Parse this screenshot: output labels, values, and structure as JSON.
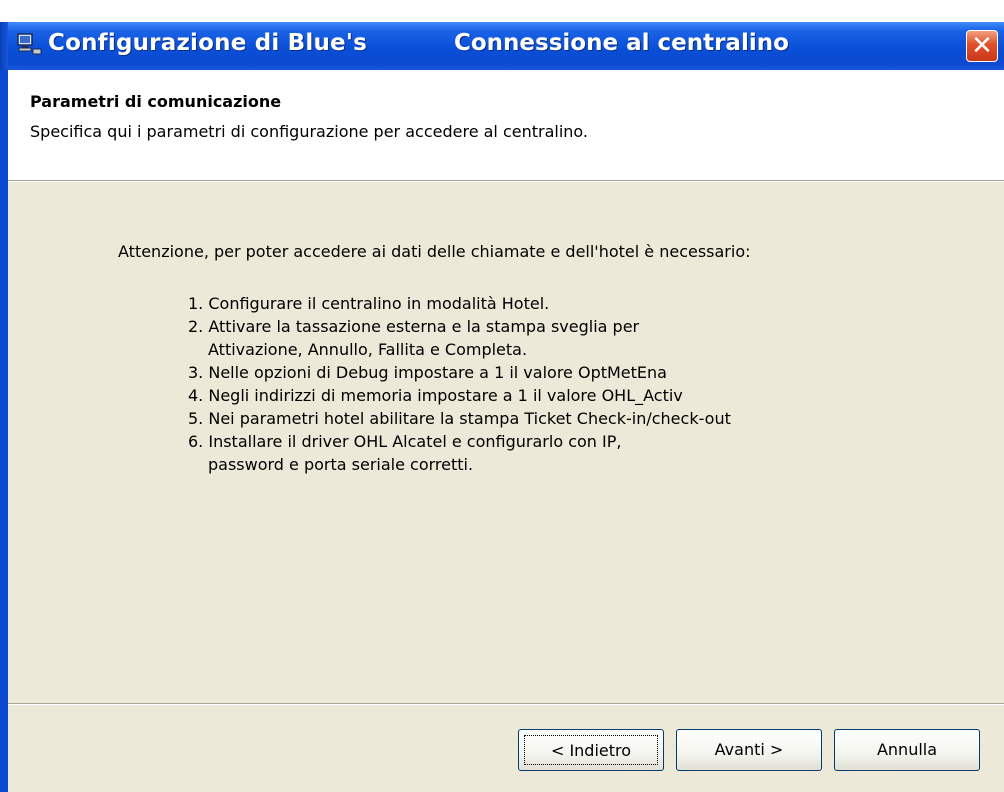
{
  "window": {
    "app_title": "Configurazione di Blue's",
    "step_title": "Connessione al centralino",
    "close_symbol": "✕",
    "icon": "computer-icon"
  },
  "header": {
    "title": "Parametri di comunicazione",
    "subtitle": "Specifica qui i parametri di configurazione per accedere al centralino."
  },
  "main": {
    "intro": "Attenzione, per poter accedere ai dati delle chiamate e dell'hotel è necessario:",
    "steps": [
      "1. Configurare il centralino in modalità Hotel.",
      "2. Attivare la tassazione esterna e la stampa sveglia per",
      "Attivazione, Annullo, Fallita e Completa.",
      "3. Nelle opzioni di Debug impostare a 1 il valore OptMetEna",
      "4. Negli indirizzi di memoria impostare a 1 il valore OHL_Activ",
      "5. Nei parametri hotel abilitare la stampa Ticket Check-in/check-out",
      "6. Installare il driver OHL Alcatel e configurarlo con IP,",
      "password e porta seriale corretti."
    ]
  },
  "buttons": {
    "back": "< Indietro",
    "next": "Avanti >",
    "cancel": "Annulla"
  },
  "colors": {
    "titlebar": "#0b4ad0",
    "dialog_bg": "#ece9d8",
    "close": "#e0502a"
  }
}
